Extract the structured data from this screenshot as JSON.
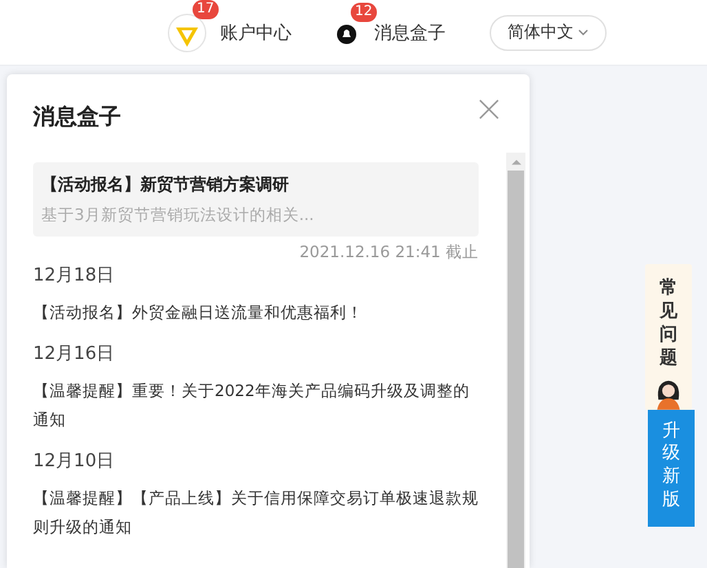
{
  "header": {
    "account": {
      "label": "账户中心",
      "badge": "17"
    },
    "messages": {
      "label": "消息盒子",
      "badge": "12"
    },
    "language": {
      "label": "简体中文"
    }
  },
  "panel": {
    "title": "消息盒子",
    "featured": {
      "title": "【活动报名】新贸节营销方案调研",
      "summary": "基于3月新贸节营销玩法设计的相关...",
      "deadline": "2021.12.16 21:41 截止"
    },
    "groups": [
      {
        "date": "12月18日",
        "messages": [
          "【活动报名】外贸金融日送流量和优惠福利！"
        ]
      },
      {
        "date": "12月16日",
        "messages": [
          "【温馨提醒】重要！关于2022年海关产品编码升级及调整的通知"
        ]
      },
      {
        "date": "12月10日",
        "messages": [
          "【温馨提醒】【产品上线】关于信用保障交易订单极速退款规则升级的通知"
        ]
      }
    ]
  },
  "side": {
    "faq": "常见问题",
    "upgrade": "升级新版"
  }
}
